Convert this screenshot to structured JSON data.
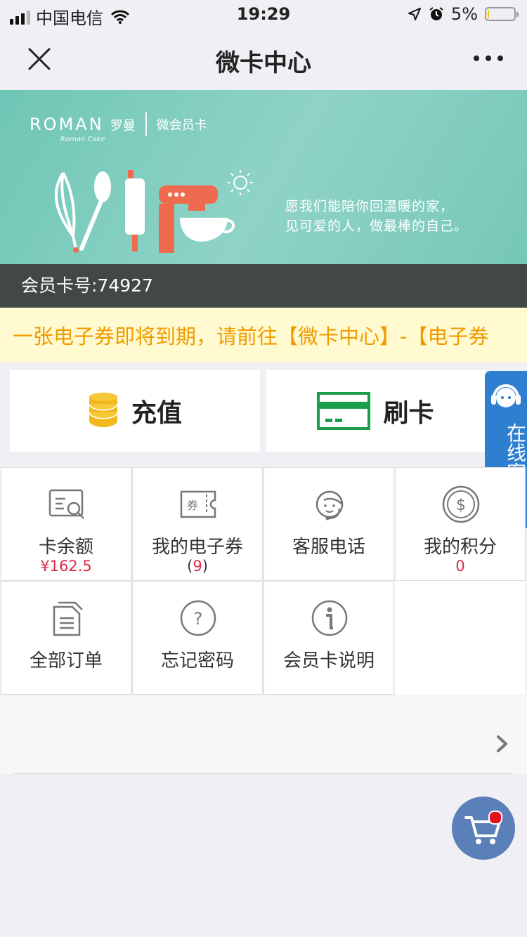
{
  "status_bar": {
    "carrier": "中国电信",
    "time": "19:29",
    "battery_percent": "5%",
    "battery_level": 0.05
  },
  "nav": {
    "title": "微卡中心"
  },
  "banner": {
    "brand_name": "ROMAN",
    "brand_cn": "罗曼",
    "brand_sub": "Roman Cake",
    "card_type": "微会员卡",
    "slogan_line1": "愿我们能陪你回温暖的家，",
    "slogan_line2": "见可爱的人，做最棒的自己。",
    "card_number": "会员卡号:74927"
  },
  "notice": {
    "text": "一张电子券即将到期，请前往【微卡中心】-【电子券"
  },
  "actions": {
    "recharge": "充值",
    "swipe": "刷卡"
  },
  "float_service": {
    "label": "在线客服"
  },
  "grid": {
    "balance_label": "卡余额",
    "balance_value": "¥162.5",
    "coupons_label": "我的电子券",
    "coupons_open": "(",
    "coupons_count": "9",
    "coupons_close": ")",
    "service_label": "客服电话",
    "points_label": "我的积分",
    "points_value": "0",
    "orders_label": "全部订单",
    "forgot_label": "忘记密码",
    "card_info_label": "会员卡说明"
  },
  "colors": {
    "banner": "#7dccbe",
    "notice_text": "#f29b00",
    "accent_red": "#e0284a",
    "float_blue": "#2f7fd0",
    "cart_blue": "#5b7fb8"
  }
}
